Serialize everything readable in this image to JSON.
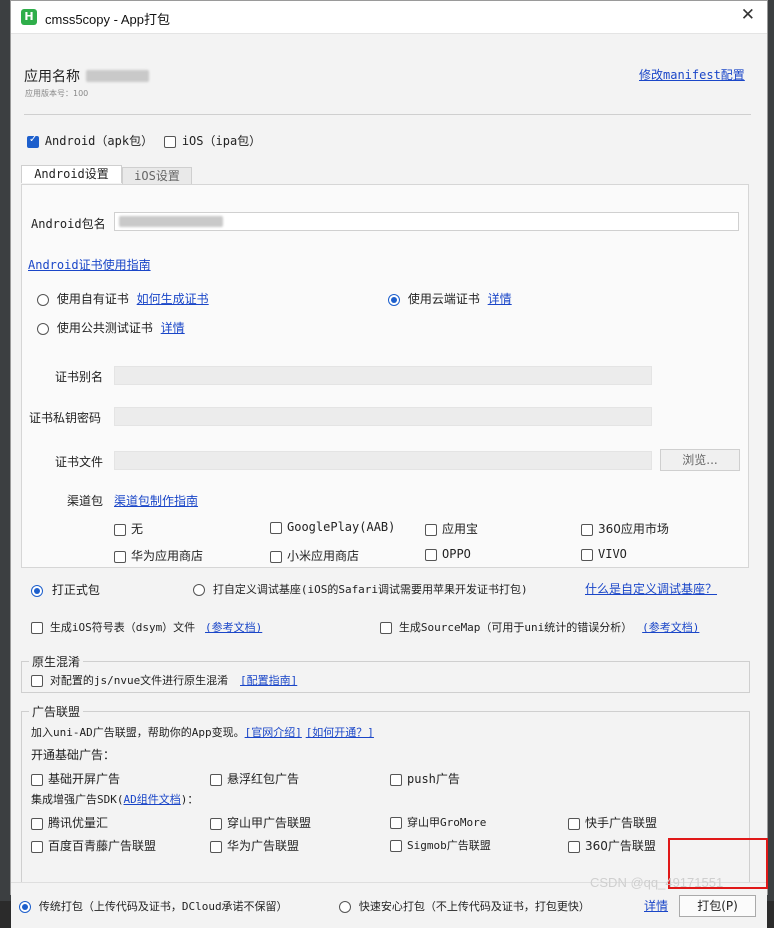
{
  "window": {
    "title": "cmss5copy - App打包",
    "icon_letter": "H"
  },
  "header": {
    "app_name_label": "应用名称",
    "version_label": "应用版本号：100",
    "modify_link": "修改manifest配置"
  },
  "platforms": {
    "android_label": "Android（apk包）",
    "ios_label": "iOS（ipa包）"
  },
  "tabs": [
    {
      "label": "Android设置"
    },
    {
      "label": "iOS设置"
    }
  ],
  "android": {
    "package_label": "Android包名",
    "cert_guide_link": "Android证书使用指南",
    "own_cert_label": "使用自有证书",
    "how_to_generate_link": "如何生成证书",
    "cloud_cert_label": "使用云端证书",
    "cloud_detail_link": "详情",
    "public_cert_label": "使用公共测试证书",
    "public_detail_link": "详情",
    "cert_alias_label": "证书别名",
    "cert_password_label": "证书私钥密码",
    "cert_file_label": "证书文件",
    "browse_button": "浏览...",
    "channel_label": "渠道包",
    "channel_guide_link": "渠道包制作指南",
    "channels": [
      "无",
      "GooglePlay(AAB)",
      "应用宝",
      "360应用市场",
      "华为应用商店",
      "小米应用商店",
      "OPPO",
      "VIVO"
    ]
  },
  "build": {
    "formal_label": "打正式包",
    "custom_label": "打自定义调试基座(iOS的Safari调试需要用苹果开发证书打包)",
    "custom_link": "什么是自定义调试基座？",
    "dsym_label": "生成iOS符号表（dsym）文件",
    "dsym_link": "(参考文档)",
    "sourcemap_label": "生成SourceMap（可用于uni统计的错误分析）",
    "sourcemap_link": "(参考文档)"
  },
  "obfuscation": {
    "title": "原生混淆",
    "label": "对配置的js/nvue文件进行原生混淆",
    "link": "[配置指南]"
  },
  "ads": {
    "title": "广告联盟",
    "intro": "加入uni-AD广告联盟，帮助你的App变现。",
    "link_site": "[官网介绍]",
    "link_how": "[如何开通？]",
    "basic_title": "开通基础广告：",
    "basic": [
      "基础开屏广告",
      "悬浮红包广告",
      "push广告"
    ],
    "sdk_title_prefix": "集成增强广告SDK(",
    "sdk_title_link": "AD组件文档",
    "sdk_title_suffix": ")：",
    "sdk_row1": [
      "腾讯优量汇",
      "穿山甲广告联盟",
      "穿山甲GroMore",
      "快手广告联盟"
    ],
    "sdk_row2": [
      "百度百青藤广告联盟",
      "华为广告联盟",
      "Sigmob广告联盟",
      "360广告联盟"
    ]
  },
  "bottom": {
    "traditional_label": "传统打包（上传代码及证书，DCloud承诺不保留）",
    "fast_label": "快速安心打包（不上传代码及证书，打包更快）",
    "detail_link": "详情",
    "pack_button": "打包(P)",
    "watermark": "CSDN @qq_49171551"
  }
}
